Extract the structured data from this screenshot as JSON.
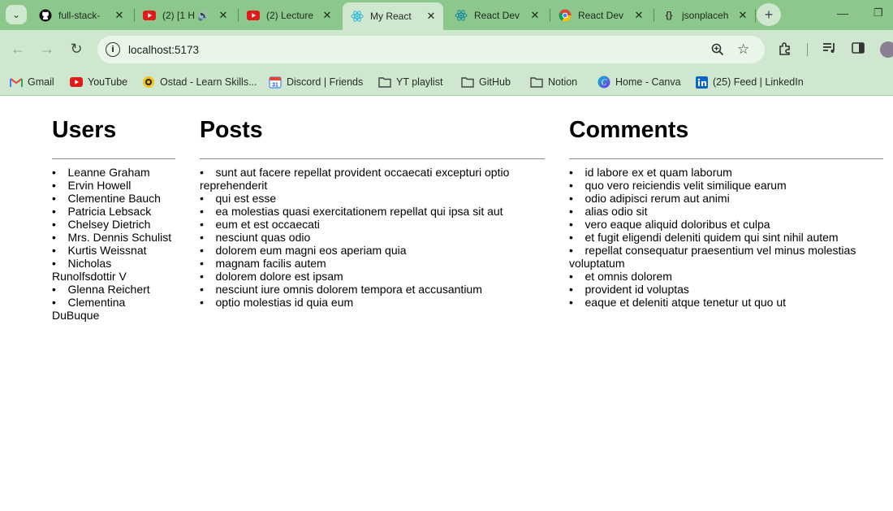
{
  "browser": {
    "tabs": [
      {
        "title": "full-stack-",
        "icon": "github-icon"
      },
      {
        "title": "(2) [1 H",
        "icon": "youtube-icon",
        "audio": true
      },
      {
        "title": "(2) Lecture",
        "icon": "youtube-icon"
      },
      {
        "title": "My React",
        "icon": "react-icon",
        "active": true
      },
      {
        "title": "React Dev",
        "icon": "react-icon"
      },
      {
        "title": "React Dev",
        "icon": "chrome-icon"
      },
      {
        "title": "jsonplaceh",
        "icon": "json-icon"
      }
    ],
    "new_tab": "+",
    "address": "localhost:5173",
    "bookmarks": [
      {
        "label": "Gmail",
        "icon": "gmail-icon"
      },
      {
        "label": "YouTube",
        "icon": "youtube-icon"
      },
      {
        "label": "Ostad - Learn Skills...",
        "icon": "ostad-icon"
      },
      {
        "label": "Discord | Friends",
        "icon": "calendar-icon"
      },
      {
        "label": "YT playlist",
        "icon": "folder-icon"
      },
      {
        "label": "GitHub",
        "icon": "folder-icon"
      },
      {
        "label": "Notion",
        "icon": "folder-icon"
      },
      {
        "label": "Home - Canva",
        "icon": "canva-icon"
      },
      {
        "label": "(25) Feed | LinkedIn",
        "icon": "linkedin-icon"
      }
    ],
    "colors": {
      "frame": "#8cc78c",
      "toolbar": "#cfe6cf"
    }
  },
  "page": {
    "users": {
      "heading": "Users",
      "items": [
        "Leanne Graham",
        "Ervin Howell",
        "Clementine Bauch",
        "Patricia Lebsack",
        "Chelsey Dietrich",
        "Mrs. Dennis Schulist",
        "Kurtis Weissnat",
        "Nicholas Runolfsdottir V",
        "Glenna Reichert",
        "Clementina DuBuque"
      ]
    },
    "posts": {
      "heading": "Posts",
      "items": [
        "sunt aut facere repellat provident occaecati excepturi optio reprehenderit",
        "qui est esse",
        "ea molestias quasi exercitationem repellat qui ipsa sit aut",
        "eum et est occaecati",
        "nesciunt quas odio",
        "dolorem eum magni eos aperiam quia",
        "magnam facilis autem",
        "dolorem dolore est ipsam",
        "nesciunt iure omnis dolorem tempora et accusantium",
        "optio molestias id quia eum"
      ]
    },
    "comments": {
      "heading": "Comments",
      "items": [
        "id labore ex et quam laborum",
        "quo vero reiciendis velit similique earum",
        "odio adipisci rerum aut animi",
        "alias odio sit",
        "vero eaque aliquid doloribus et culpa",
        "et fugit eligendi deleniti quidem qui sint nihil autem",
        "repellat consequatur praesentium vel minus molestias voluptatum",
        "et omnis dolorem",
        "provident id voluptas",
        "eaque et deleniti atque tenetur ut quo ut"
      ]
    }
  }
}
